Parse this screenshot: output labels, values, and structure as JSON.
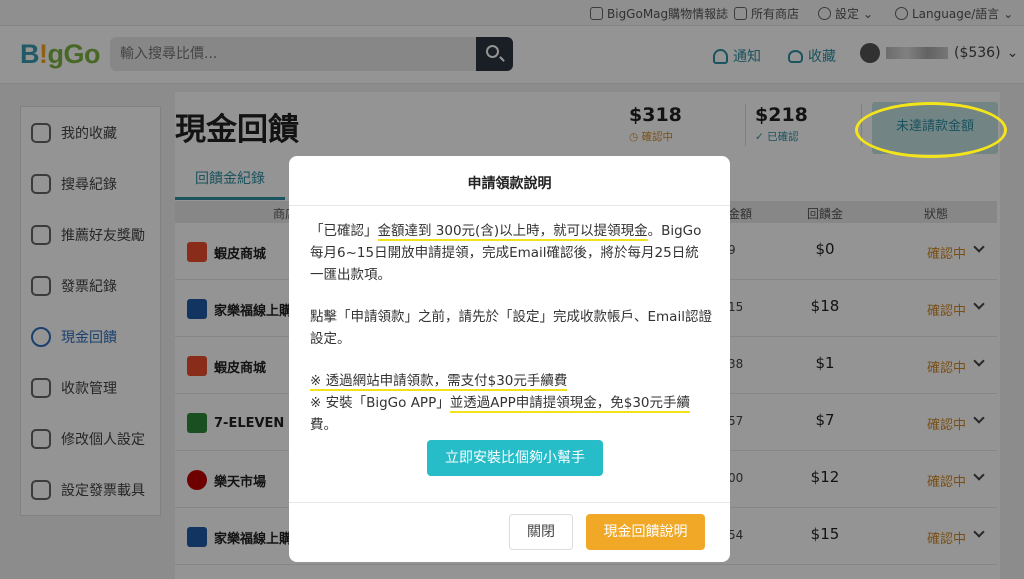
{
  "topbar": {
    "blog": "BigGoMag購物情報誌",
    "stores": "所有商店",
    "settings": "設定",
    "language": "Language/語言"
  },
  "header": {
    "logo": {
      "p1": "B",
      "p2": "!",
      "p3": "gGo"
    },
    "search_placeholder": "輸入搜尋比價...",
    "notify": "通知",
    "favorites": "收藏",
    "balance": "($536)"
  },
  "sidebar": {
    "items": [
      {
        "label": "我的收藏",
        "icon": "heart-plus-icon"
      },
      {
        "label": "搜尋紀錄",
        "icon": "history-icon"
      },
      {
        "label": "推薦好友獎勵",
        "icon": "user-add-icon"
      },
      {
        "label": "發票紀錄",
        "icon": "receipt-icon"
      },
      {
        "label": "現金回饋",
        "icon": "dollar-coin-icon"
      },
      {
        "label": "收款管理",
        "icon": "bank-icon"
      },
      {
        "label": "修改個人設定",
        "icon": "gear-icon"
      },
      {
        "label": "設定發票載具",
        "icon": "invoice-carrier-icon"
      }
    ],
    "active_index": 4
  },
  "main": {
    "title": "現金回饋",
    "stat_pending": {
      "amount": "$318",
      "label": "確認中"
    },
    "stat_confirmed": {
      "amount": "$218",
      "label": "已確認"
    },
    "pending_button": "未達請款金額",
    "tab": "回饋金紀錄",
    "columns": {
      "store": "商店",
      "amount": "金額",
      "cashback": "回饋金",
      "status": "狀態"
    },
    "rows": [
      {
        "store": "蝦皮商城",
        "amount": "9",
        "cashback": "$0",
        "status": "確認中",
        "logo_color": "#ee4d2d"
      },
      {
        "store": "家樂福線上購物",
        "amount": "15",
        "cashback": "$18",
        "status": "確認中",
        "logo_color": "#1e5aa8"
      },
      {
        "store": "蝦皮商城",
        "amount": "38",
        "cashback": "$1",
        "status": "確認中",
        "logo_color": "#ee4d2d"
      },
      {
        "store": "7-ELEVEN",
        "amount": "57",
        "cashback": "$7",
        "status": "確認中",
        "logo_color": "#2e8b3a"
      },
      {
        "store": "樂天市場",
        "amount": "00",
        "cashback": "$12",
        "status": "確認中",
        "logo_color": "#bf0000"
      },
      {
        "store": "家樂福線上購物",
        "amount": "54",
        "cashback": "$15",
        "status": "確認中",
        "logo_color": "#1e5aa8"
      }
    ]
  },
  "modal": {
    "title": "申請領款說明",
    "p1a": "「已確認」",
    "p1b": "金額達到 300元(含)以上時，就可以提領現金",
    "p1c": "。BigGo每月6~15日開放申請提領，完成Email確認後，將於每月25日統一匯出款項。",
    "p2": "點擊「申請領款」之前，請先於「設定」完成收款帳戶、Email認證設定。",
    "note1": "※ 透過網站申請領款，需支付$30元手續費",
    "note2a": "※ 安裝「BigGo APP」",
    "note2b": "並透過APP申請提領現金，免$30元手續",
    "note2c": "費。",
    "install_button": "立即安裝比個夠小幫手",
    "close_button": "關閉",
    "explain_button": "現金回饋說明"
  },
  "colors": {
    "accent": "#2f8fa3",
    "install": "#26bcc8",
    "explain": "#f0a826",
    "highlight": "#f2e21b",
    "status": "#d08a2a"
  }
}
